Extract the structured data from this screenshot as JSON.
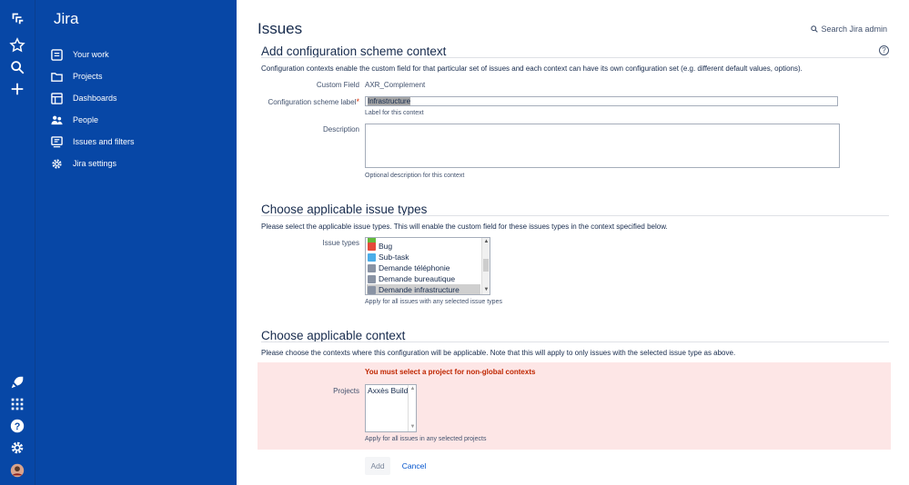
{
  "global_nav": {
    "top_icons": [
      "jira-logo-icon",
      "star-icon",
      "search-icon",
      "create-plus-icon"
    ],
    "bottom_icons": [
      "rocket-icon",
      "app-switcher-icon",
      "help-icon",
      "settings-icon",
      "avatar"
    ]
  },
  "sidebar": {
    "title": "Jira",
    "items": [
      {
        "label": "Your work",
        "icon": "your-work-icon"
      },
      {
        "label": "Projects",
        "icon": "folder-icon"
      },
      {
        "label": "Dashboards",
        "icon": "dashboard-icon"
      },
      {
        "label": "People",
        "icon": "people-icon"
      },
      {
        "label": "Issues and filters",
        "icon": "issues-icon"
      },
      {
        "label": "Jira settings",
        "icon": "gear-icon"
      }
    ]
  },
  "header": {
    "title": "Issues",
    "search_label": "Search Jira admin"
  },
  "add_context": {
    "heading": "Add configuration scheme context",
    "description": "Configuration contexts enable the custom field for that particular set of issues and each context can have its own configuration set (e.g. different default values, options).",
    "custom_field_label": "Custom Field",
    "custom_field_value": "AXR_Complement",
    "scheme_label_label": "Configuration scheme label",
    "scheme_label_value": "Infrastructure",
    "scheme_label_help": "Label for this context",
    "description_label": "Description",
    "description_value": "",
    "description_help": "Optional description for this context"
  },
  "issue_types": {
    "heading": "Choose applicable issue types",
    "description": "Please select the applicable issue types. This will enable the custom field for these issues types in the context specified below.",
    "label": "Issue types",
    "options": [
      {
        "label": "Bug",
        "color": "#e5493a",
        "selected": false
      },
      {
        "label": "Sub-task",
        "color": "#4bade8",
        "selected": false
      },
      {
        "label": "Demande téléphonie",
        "color": "#8993a4",
        "selected": false
      },
      {
        "label": "Demande bureautique",
        "color": "#8993a4",
        "selected": false
      },
      {
        "label": "Demande infrastructure",
        "color": "#8993a4",
        "selected": true
      }
    ],
    "help": "Apply for all issues with any selected issue types"
  },
  "context": {
    "heading": "Choose applicable context",
    "description": "Please choose the contexts where this configuration will be applicable. Note that this will apply to only issues with the selected issue type as above.",
    "error": "You must select a project for non-global contexts",
    "projects_label": "Projects",
    "projects": [
      "Axxès Build"
    ],
    "help": "Apply for all issues in any selected projects"
  },
  "actions": {
    "add_label": "Add",
    "cancel_label": "Cancel"
  },
  "colors": {
    "sidebar_bg": "#0747a6",
    "error_bg": "#fde6e6",
    "error_text": "#bf2600",
    "link": "#0052cc"
  }
}
